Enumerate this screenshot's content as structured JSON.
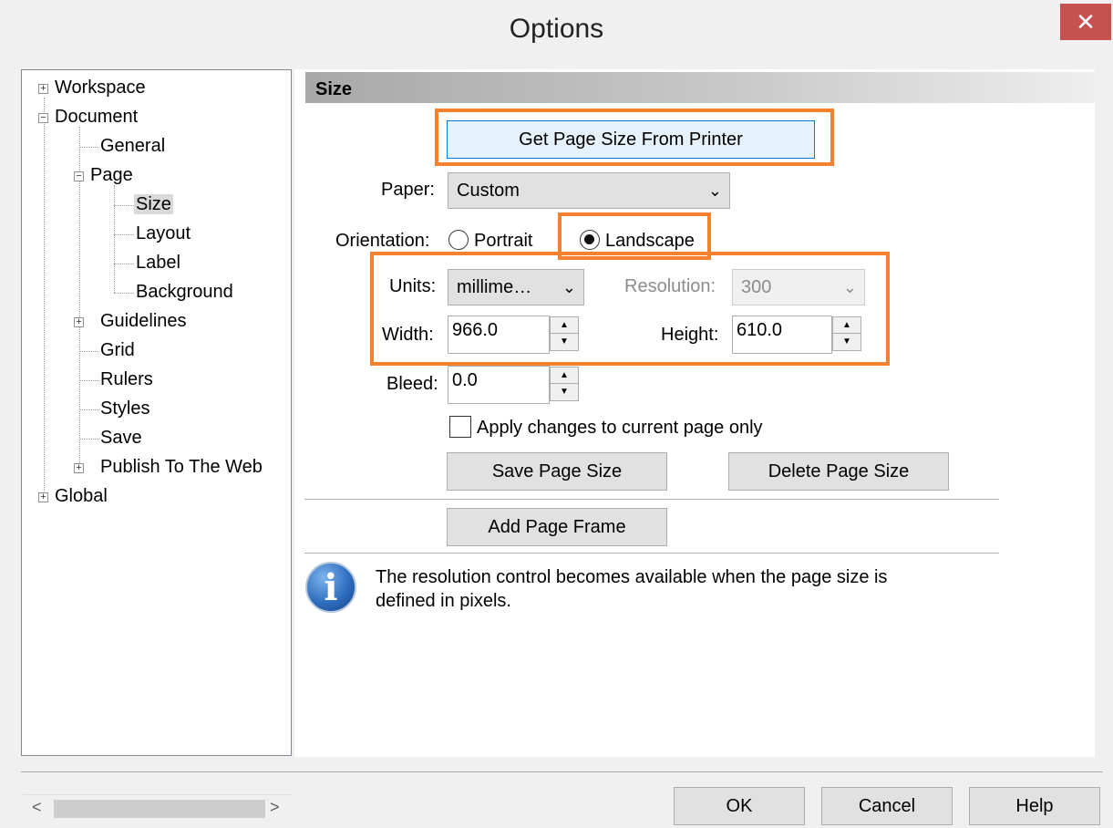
{
  "window": {
    "title": "Options",
    "close_glyph": "✕"
  },
  "tree": {
    "items": [
      {
        "label": "Workspace",
        "expander": "+"
      },
      {
        "label": "Document",
        "expander": "−"
      },
      {
        "label": "General"
      },
      {
        "label": "Page",
        "expander": "−"
      },
      {
        "label": "Size",
        "selected": true
      },
      {
        "label": "Layout"
      },
      {
        "label": "Label"
      },
      {
        "label": "Background"
      },
      {
        "label": "Guidelines",
        "expander": "+"
      },
      {
        "label": "Grid"
      },
      {
        "label": "Rulers"
      },
      {
        "label": "Styles"
      },
      {
        "label": "Save"
      },
      {
        "label": "Publish To The Web",
        "expander": "+"
      },
      {
        "label": "Global",
        "expander": "+"
      }
    ],
    "scroll_left": "<",
    "scroll_right": ">"
  },
  "section": {
    "title": "Size"
  },
  "get_page_size_button": "Get Page Size From Printer",
  "paper": {
    "label": "Paper:",
    "value": "Custom"
  },
  "orientation": {
    "label": "Orientation:",
    "portrait_label": "Portrait",
    "landscape_label": "Landscape",
    "selected": "Landscape"
  },
  "units": {
    "label": "Units:",
    "value": "millime…"
  },
  "resolution": {
    "label": "Resolution:",
    "value": "300",
    "enabled": false
  },
  "width": {
    "label": "Width:",
    "value": "966.0"
  },
  "height": {
    "label": "Height:",
    "value": "610.0"
  },
  "bleed": {
    "label": "Bleed:",
    "value": "0.0"
  },
  "apply_current_page_only": {
    "label": "Apply changes to current page only",
    "checked": false
  },
  "buttons": {
    "save_page_size": "Save Page Size",
    "delete_page_size": "Delete Page Size",
    "add_page_frame": "Add Page Frame"
  },
  "info": {
    "text_line1": "The resolution control becomes available when the page size is",
    "text_line2": "defined in pixels."
  },
  "footer": {
    "ok": "OK",
    "cancel": "Cancel",
    "help": "Help"
  },
  "colors": {
    "highlight": "#f4812f",
    "close_button": "#c75050",
    "info_icon": "#2f6fc0"
  }
}
